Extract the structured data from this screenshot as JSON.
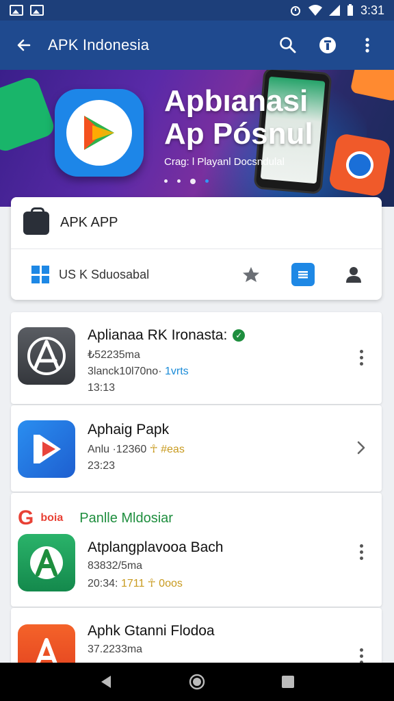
{
  "status_bar": {
    "time": "3:31"
  },
  "app_bar": {
    "title": "APK Indonesia"
  },
  "banner": {
    "headline_line1": "Apbıanasi",
    "headline_line2": "Ap Pósnul",
    "subline": "Crag: l Playanl Docsndulal",
    "dots": 4,
    "active_dot": 2
  },
  "featured": {
    "app_name": "APK APP",
    "developer": "US K Sduosabal"
  },
  "list": [
    {
      "title": "Aplianaa RK Ironasta:",
      "verified": true,
      "meta1": "₺52235ma",
      "meta2": "3lanck10l70no·",
      "meta2_accent": "1vrts",
      "meta3": "13:13",
      "action": "more-icon"
    },
    {
      "title": "Aphaig Papk",
      "meta1": "Anlu ·12360",
      "meta1_accent": "☥ #eas",
      "meta2": "23:23",
      "action": "chevron-right-icon"
    },
    {
      "section_logo": "G",
      "section_logo_word": "boia",
      "section_title": "Panlle Mldosiar",
      "title": "Atplangplavooa Bach",
      "meta1": "83832/5ma",
      "meta2": "20:34:",
      "meta2_accent": "1711 ☥ 0oos",
      "action": "more-icon"
    },
    {
      "title": "Aphk Gtanni Flodoa",
      "meta1": "37.2233ma",
      "action": "more-icon"
    }
  ],
  "colors": {
    "app_bar": "#1f4a8f",
    "status_bar": "#1d3f7a",
    "accent_green": "#1e8e3e",
    "accent_blue": "#1e88e5"
  }
}
